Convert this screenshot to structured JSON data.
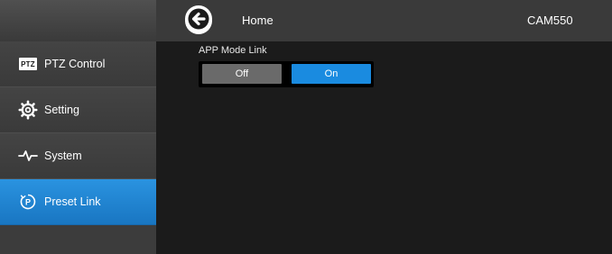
{
  "header": {
    "home_label": "Home",
    "device_name": "CAM550",
    "back_icon": "arrow-left-circle-icon"
  },
  "sidebar": {
    "items": [
      {
        "label": "PTZ Control",
        "icon": "ptz-badge-icon",
        "badge_text": "PTZ",
        "active": false
      },
      {
        "label": "Setting",
        "icon": "gear-icon",
        "active": false
      },
      {
        "label": "System",
        "icon": "pulse-icon",
        "active": false
      },
      {
        "label": "Preset Link",
        "icon": "preset-p-icon",
        "active": true
      }
    ]
  },
  "main": {
    "section_title": "APP Mode Link",
    "toggle": {
      "off_label": "Off",
      "on_label": "On",
      "selected": "On"
    }
  },
  "colors": {
    "active_blue": "#1a8be0",
    "background": "#1b1b1b",
    "header": "#3a3a3a"
  }
}
